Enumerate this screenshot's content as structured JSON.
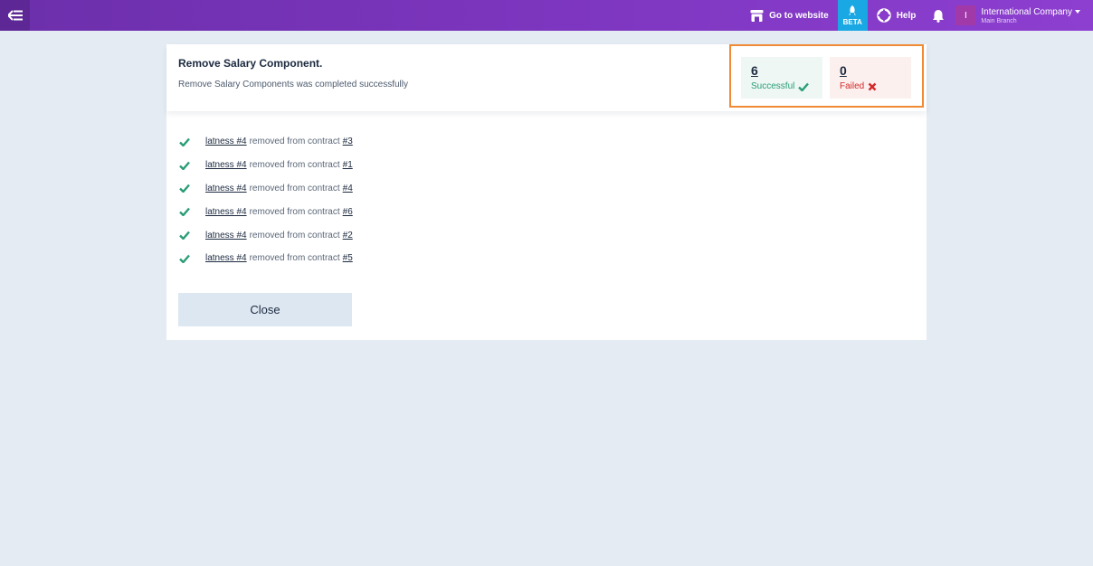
{
  "topbar": {
    "go_to_website": "Go to website",
    "beta": "BETA",
    "help": "Help",
    "company_name": "International Company",
    "company_branch": "Main Branch",
    "avatar_initial": "I",
    "colors": {
      "bar_start": "#6c2fab",
      "bar_end": "#8d3fd0",
      "beta": "#1aa8e4"
    }
  },
  "dialog": {
    "title": "Remove Salary Component.",
    "subtitle": "Remove Salary Components was completed successfully",
    "stats": {
      "successful_count": "6",
      "successful_label": "Successful",
      "failed_count": "0",
      "failed_label": "Failed"
    },
    "results": [
      {
        "item": "latness #4",
        "text": "removed from contract",
        "contract": "#3"
      },
      {
        "item": "latness #4",
        "text": "removed from contract",
        "contract": "#1"
      },
      {
        "item": "latness #4",
        "text": "removed from contract",
        "contract": "#4"
      },
      {
        "item": "latness #4",
        "text": "removed from contract",
        "contract": "#6"
      },
      {
        "item": "latness #4",
        "text": "removed from contract",
        "contract": "#2"
      },
      {
        "item": "latness #4",
        "text": "removed from contract",
        "contract": "#5"
      }
    ],
    "close_label": "Close"
  },
  "icons": {
    "menu": "menu-collapse-icon",
    "website": "store-icon",
    "beta": "rocket-icon",
    "help": "lifebuoy-icon",
    "notifications": "bell-icon",
    "dropdown": "caret-down-icon",
    "success": "check-icon",
    "failure": "x-icon"
  }
}
